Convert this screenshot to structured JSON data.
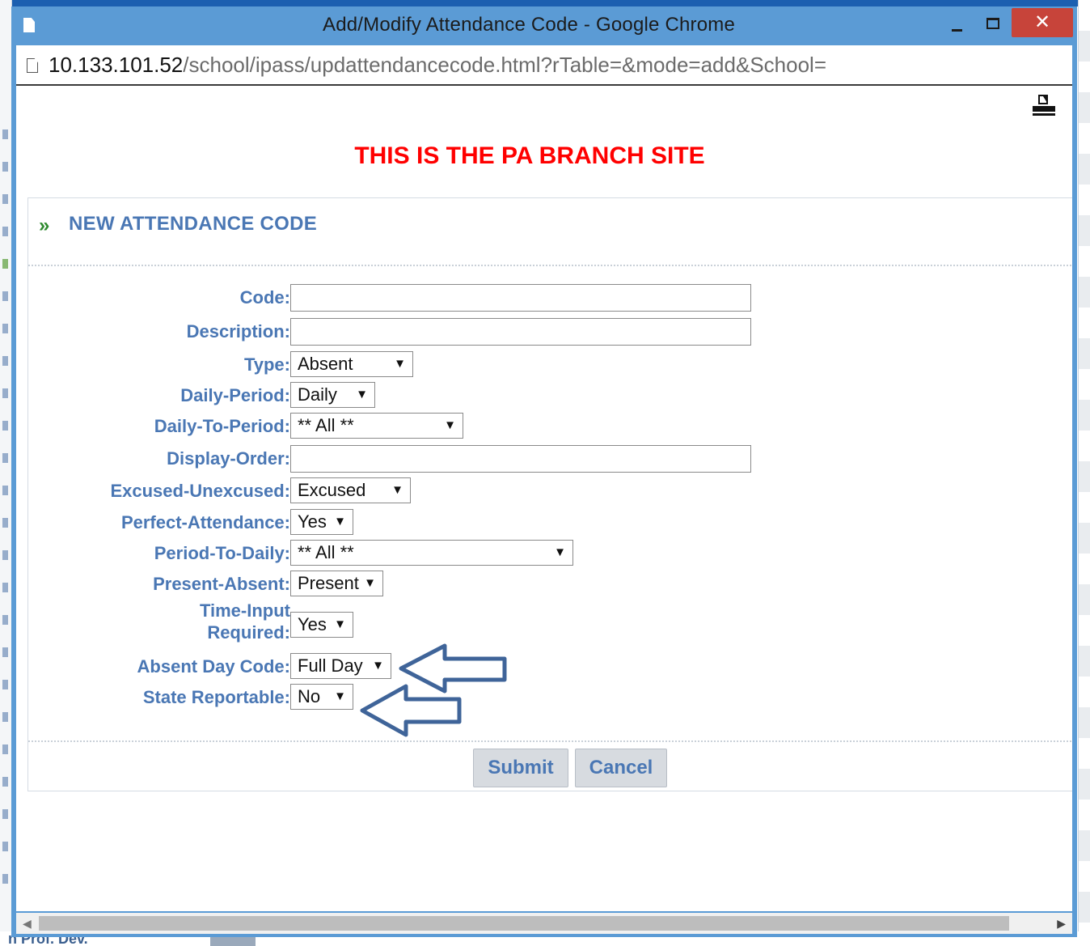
{
  "window": {
    "title": "Add/Modify Attendance Code - Google Chrome",
    "close_glyph": "✕"
  },
  "address": {
    "host": "10.133.101.52",
    "path": "/school/ipass/updattendancecode.html?rTable=&mode=add&School="
  },
  "banner": "THIS IS THE PA BRANCH SITE",
  "panel": {
    "chevron": "»",
    "title": "NEW ATTENDANCE CODE"
  },
  "form": {
    "code": {
      "label": "Code:",
      "value": ""
    },
    "description": {
      "label": "Description:",
      "value": ""
    },
    "type": {
      "label": "Type:",
      "selected": "Absent"
    },
    "daily_period": {
      "label": "Daily-Period:",
      "selected": "Daily"
    },
    "daily_to_period": {
      "label": "Daily-To-Period:",
      "selected": "** All **"
    },
    "display_order": {
      "label": "Display-Order:",
      "value": ""
    },
    "excused_unexcused": {
      "label": "Excused-Unexcused:",
      "selected": "Excused"
    },
    "perfect_attendance": {
      "label": "Perfect-Attendance:",
      "selected": "Yes"
    },
    "period_to_daily": {
      "label": "Period-To-Daily:",
      "selected": "** All **"
    },
    "present_absent": {
      "label": "Present-Absent:",
      "selected": "Present"
    },
    "time_input_required": {
      "label_line1": "Time-Input",
      "label_line2": "Required:",
      "selected": "Yes"
    },
    "absent_day_code": {
      "label": "Absent Day Code:",
      "selected": "Full Day"
    },
    "state_reportable": {
      "label": "State Reportable:",
      "selected": "No"
    }
  },
  "buttons": {
    "submit": "Submit",
    "cancel": "Cancel"
  },
  "dropdown_arrow": "▼",
  "scrollbar": {
    "left": "◀",
    "right": "▶"
  },
  "colors": {
    "titlebar": "#5b9bd5",
    "banner": "#ff0000",
    "label": "#4a77b4",
    "annotation_arrow": "#3f6499"
  },
  "background_page": {
    "bottom_text": "n Prof. Dev."
  }
}
